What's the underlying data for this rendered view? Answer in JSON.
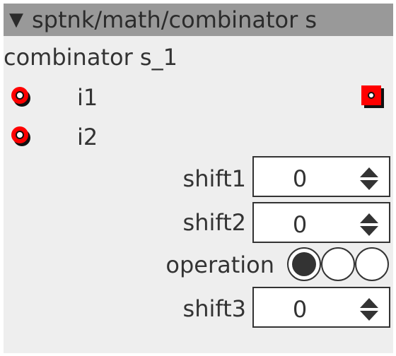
{
  "node": {
    "title": "sptnk/math/combinator s",
    "collapse_icon": "collapse-triangle-icon",
    "instance_name": "combinator s_1"
  },
  "inputs": [
    {
      "label": "i1",
      "icon": "input-port-icon"
    },
    {
      "label": "i2",
      "icon": "input-port-icon"
    }
  ],
  "output": {
    "icon": "output-port-icon"
  },
  "params": {
    "shift1": {
      "label": "shift1",
      "value": "0"
    },
    "shift2": {
      "label": "shift2",
      "value": "0"
    },
    "operation": {
      "label": "operation",
      "options_count": 3,
      "selected_index": 0
    },
    "shift3": {
      "label": "shift3",
      "value": "0"
    }
  },
  "colors": {
    "title_bar": "#999999",
    "node_background": "#eeeeee",
    "port_red": "#ff0000",
    "port_shadow": "#111111",
    "radio_selected": "#333333"
  }
}
